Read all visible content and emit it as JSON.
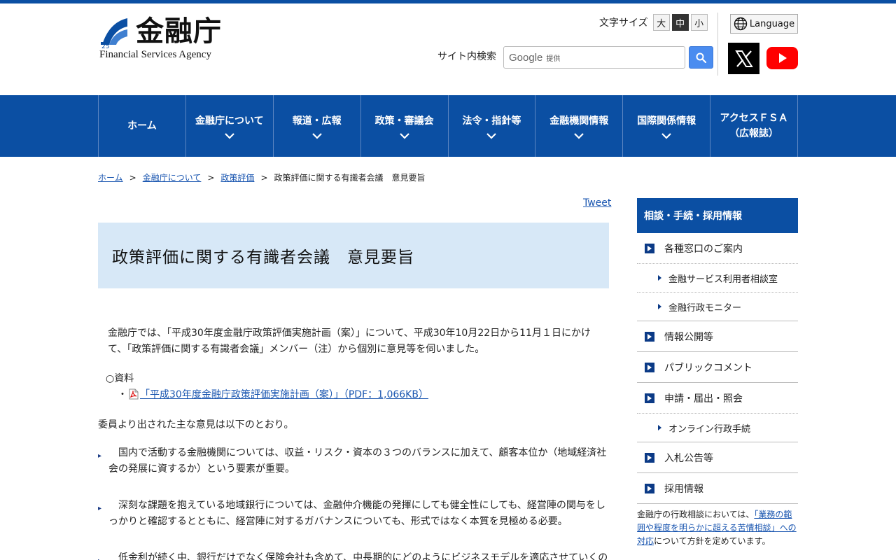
{
  "header": {
    "logo_jp": "金融庁",
    "logo_en": "Financial Services Agency",
    "logo_badge": "25",
    "font_size_label": "文字サイズ",
    "font_sizes": [
      "大",
      "中",
      "小"
    ],
    "language_label": "Language",
    "search_label": "サイト内検索",
    "search_google": "Google",
    "search_provided": "提供"
  },
  "nav": {
    "items": [
      {
        "label": "ホーム"
      },
      {
        "label": "金融庁について"
      },
      {
        "label": "報道・広報"
      },
      {
        "label": "政策・審議会"
      },
      {
        "label": "法令・指針等"
      },
      {
        "label": "金融機関情報"
      },
      {
        "label": "国際関係情報"
      },
      {
        "label": "アクセスＦＳＡ\n（広報誌）"
      }
    ]
  },
  "breadcrumb": {
    "home": "ホーム",
    "about": "金融庁について",
    "policy": "政策評価",
    "current": "政策評価に関する有識者会議　意見要旨",
    "sep": ">"
  },
  "main": {
    "tweet": "Tweet",
    "title": "政策評価に関する有識者会議　意見要旨",
    "intro": "金融庁では、「平成30年度金融庁政策評価実施計画（案）」について、平成30年10月22日から11月１日にかけて、「政策評価に関する有識者会議」メンバー（注）から個別に意見等を伺いました。",
    "materials_head": "○資料",
    "materials_dot": "・",
    "materials_link": "「平成30年度金融庁政策評価実施計画（案）」（PDF：1,066KB）",
    "opinions_lead": "委員より出された主な意見は以下のとおり。",
    "opinions": [
      "　国内で活動する金融機関については、収益・リスク・資本の３つのバランスに加えて、顧客本位か（地域経済社会の発展に資するか）という要素が重要。",
      "　深刻な課題を抱えている地域銀行については、金融仲介機能の発揮にしても健全性にしても、経営陣の関与をしっかりと確認するとともに、経営陣に対するガバナンスについても、形式ではなく本質を見極める必要。",
      "　低金利が続く中、銀行だけでなく保険会社も含めて、中長期的にどのようにビジネスモデルを適応させていくの"
    ]
  },
  "sidebar": {
    "head": "相談・手続・採用情報",
    "items": [
      {
        "label": "各種窓口のご案内",
        "level": 1
      },
      {
        "label": "金融サービス利用者相談室",
        "level": 2
      },
      {
        "label": "金融行政モニター",
        "level": 2
      },
      {
        "label": "情報公開等",
        "level": 1
      },
      {
        "label": "パブリックコメント",
        "level": 1
      },
      {
        "label": "申請・届出・照会",
        "level": 1
      },
      {
        "label": "オンライン行政手続",
        "level": 2
      },
      {
        "label": "入札公告等",
        "level": 1
      },
      {
        "label": "採用情報",
        "level": 1
      }
    ],
    "note_pre": "金融庁の行政相談においては、",
    "note_link": "「業務の範囲や程度を明らかに超える苦情相談」への対応",
    "note_post": "について方針を定めています。"
  },
  "colors": {
    "brand_blue": "#0b4fa3",
    "title_bg": "#d7e8f7",
    "link": "#1a56b0"
  }
}
